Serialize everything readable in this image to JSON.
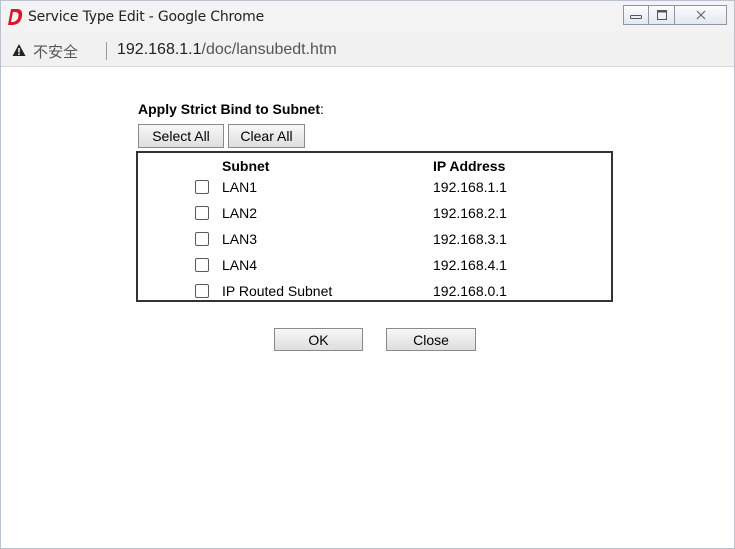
{
  "window": {
    "title": "Service Type Edit - Google Chrome",
    "app_icon": "draytek-d-logo-icon",
    "controls": [
      "minimize-icon",
      "maximize-icon",
      "close-icon"
    ]
  },
  "addressbar": {
    "security_label": "不安全",
    "url_host": "192.168.1.1",
    "url_path": "/doc/lansubedt.htm"
  },
  "form": {
    "heading": "Apply Strict Bind to Subnet",
    "heading_suffix": ":",
    "select_all_label": "Select All",
    "clear_all_label": "Clear All",
    "columns": {
      "subnet": "Subnet",
      "ip": "IP Address"
    },
    "rows": [
      {
        "subnet": "LAN1",
        "ip": "192.168.1.1",
        "checked": false
      },
      {
        "subnet": "LAN2",
        "ip": "192.168.2.1",
        "checked": false
      },
      {
        "subnet": "LAN3",
        "ip": "192.168.3.1",
        "checked": false
      },
      {
        "subnet": "LAN4",
        "ip": "192.168.4.1",
        "checked": false
      },
      {
        "subnet": "IP Routed Subnet",
        "ip": "192.168.0.1",
        "checked": false
      }
    ],
    "ok_label": "OK",
    "close_label": "Close"
  },
  "colors": {
    "logo": "#e0142a",
    "titlebar": "#f3f3f3",
    "table_border": "#333333"
  }
}
